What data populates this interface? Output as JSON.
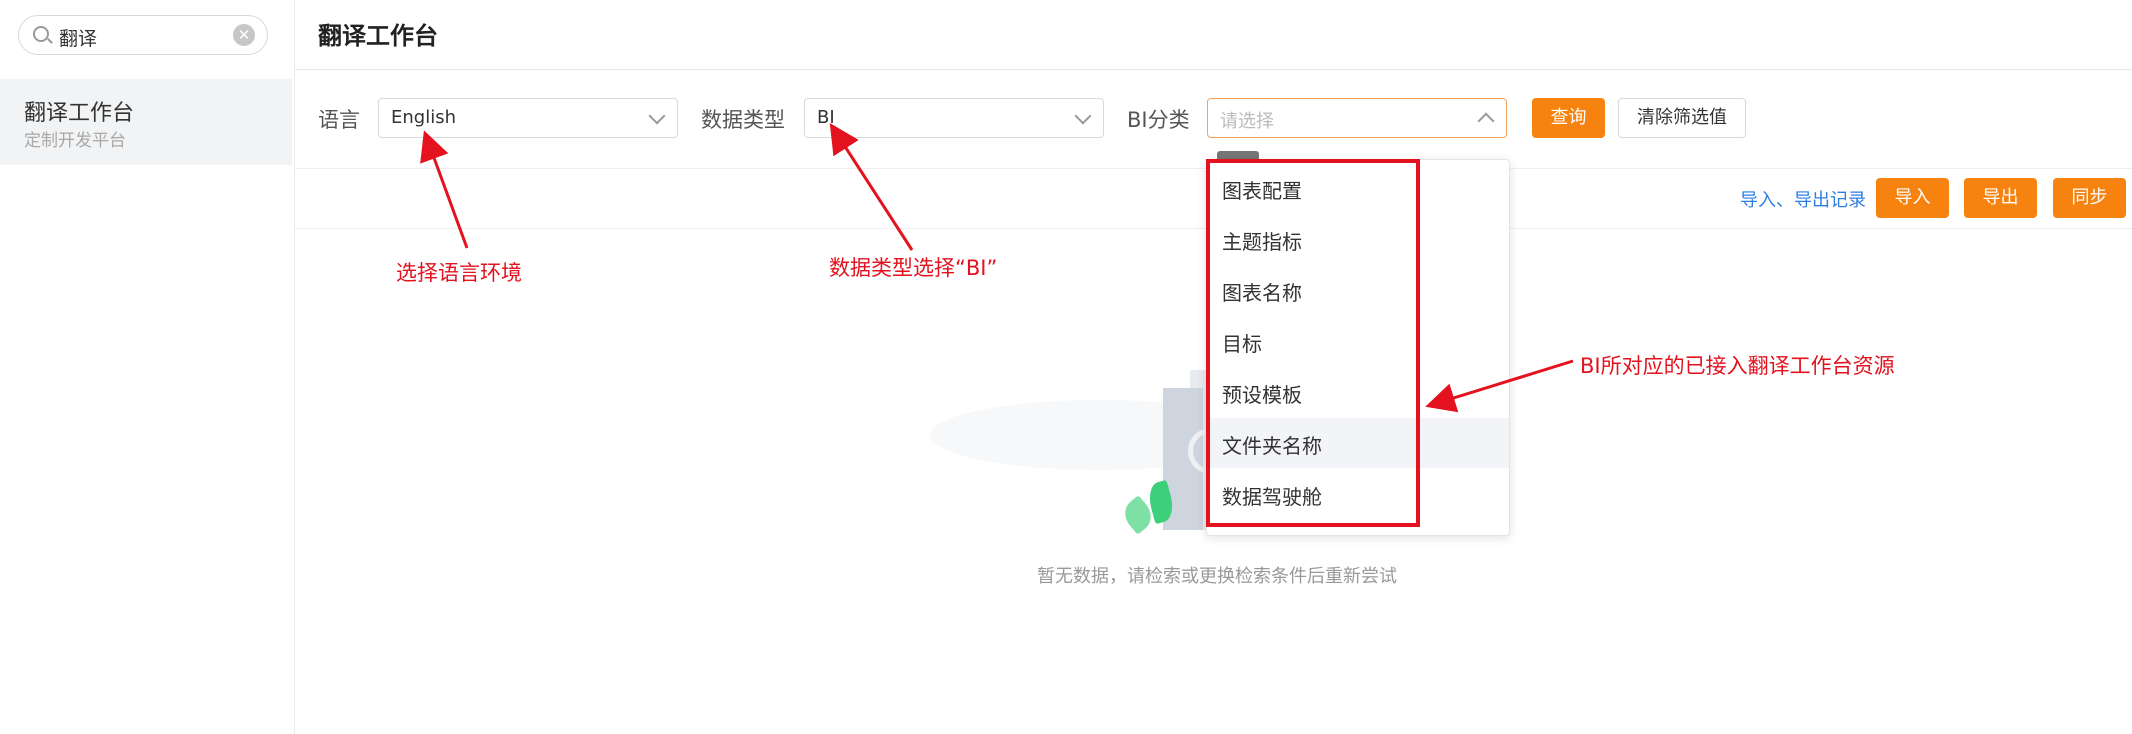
{
  "sidebar": {
    "search": {
      "value": "翻译"
    },
    "items": [
      {
        "title": "翻译工作台",
        "subtitle": "定制开发平台"
      }
    ]
  },
  "header": {
    "title": "翻译工作台"
  },
  "filters": {
    "language": {
      "label": "语言",
      "value": "English"
    },
    "data_type": {
      "label": "数据类型",
      "value": "BI"
    },
    "bi_category": {
      "label": "BI分类",
      "placeholder": "请选择"
    },
    "query_button": "查询",
    "clear_button": "清除筛选值"
  },
  "toolbar": {
    "records_link": "导入、导出记录",
    "import_button": "导入",
    "export_button": "导出",
    "sync_button": "同步"
  },
  "dropdown": {
    "options": [
      "图表配置",
      "主题指标",
      "图表名称",
      "目标",
      "预设模板",
      "文件夹名称",
      "数据驾驶舱"
    ],
    "hovered": "文件夹名称"
  },
  "empty_state": {
    "text": "暂无数据，请检索或更换检索条件后重新尝试"
  },
  "annotations": {
    "language_note": "选择语言环境",
    "data_type_note": "数据类型选择“BI”",
    "category_note": "BI所对应的已接入翻译工作台资源"
  },
  "colors": {
    "primary": "#f6830f",
    "link": "#2f7de1",
    "annotation": "#e3121e"
  }
}
